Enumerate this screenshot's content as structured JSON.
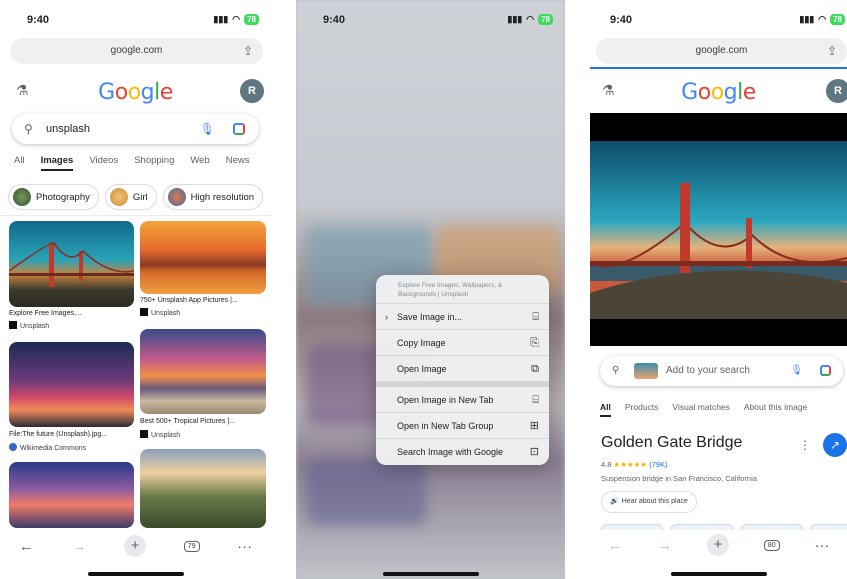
{
  "panel1": {
    "time": "9:40",
    "battery": "78",
    "url": "google.com",
    "logo": [
      "G",
      "o",
      "o",
      "g",
      "l",
      "e"
    ],
    "avatar": "R",
    "query": "unsplash",
    "tabs": [
      "All",
      "Images",
      "Videos",
      "Shopping",
      "Web",
      "News"
    ],
    "chips": [
      "Photography",
      "Girl",
      "High resolution"
    ],
    "results": [
      {
        "caption": "Explore Free Images,...",
        "source": "Unsplash"
      },
      {
        "caption": "750+ Unsplash App Pictures |...",
        "source": "Unsplash"
      },
      {
        "caption": "File:The future (Unsplash).jpg...",
        "source": "Wikimedia Commons"
      },
      {
        "caption": "Best 500+ Tropical Pictures |...",
        "source": "Unsplash"
      }
    ],
    "tab_count": "79"
  },
  "panel2": {
    "time": "9:40",
    "battery": "78",
    "menu_header": "Explore Free Images, Wallpapers, & Backgrounds | Unsplash",
    "menu_items": [
      {
        "label": "Save Image in...",
        "icon": "⌸"
      },
      {
        "label": "Copy Image",
        "icon": "⎘"
      },
      {
        "label": "Open Image",
        "icon": "⧉"
      }
    ],
    "menu_items2": [
      {
        "label": "Open Image in New Tab",
        "icon": "⌸"
      },
      {
        "label": "Open in New Tab Group",
        "icon": "⊞"
      },
      {
        "label": "Search Image with Google",
        "icon": "⊡"
      }
    ]
  },
  "panel3": {
    "time": "9:40",
    "battery": "78",
    "url": "google.com",
    "avatar": "R",
    "search_placeholder": "Add to your search",
    "tabs": [
      "All",
      "Products",
      "Visual matches",
      "About this image"
    ],
    "title": "Golden Gate Bridge",
    "rating": "4.8",
    "stars": "★★★★★",
    "rating_count": "(79K)",
    "subtitle": "Suspension bridge in San Francisco, California",
    "hear_label": "Hear about this place",
    "tab_count": "80"
  },
  "colors": {
    "accent": "#1a73e8",
    "google_blue": "#4285f4",
    "google_red": "#ea4335",
    "google_yellow": "#fbbc05",
    "google_green": "#34a853"
  }
}
